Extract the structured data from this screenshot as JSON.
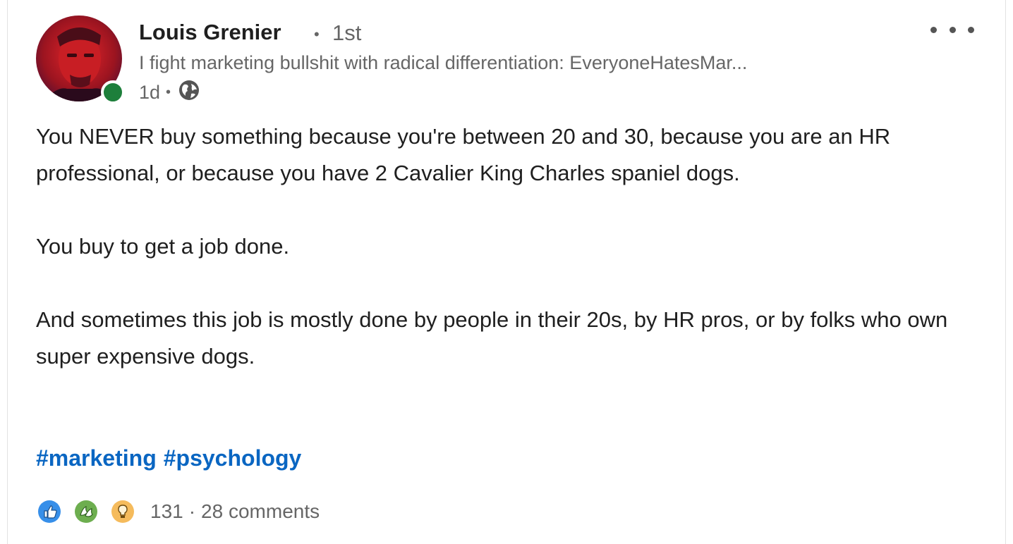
{
  "post": {
    "author": {
      "name": "Louis Grenier",
      "separator": "•",
      "degree": "1st",
      "headline": "I fight marketing bullshit with radical differentiation: EveryoneHatesMar...",
      "time": "1d",
      "time_separator": "•",
      "visibility_icon": "globe-icon",
      "online": true
    },
    "menu_icon": "more-options-icon",
    "body": [
      "You NEVER buy something because you're between 20 and 30, because you are an HR professional, or because you have 2 Cavalier King Charles spaniel dogs.",
      "You buy to get a job done.",
      "And sometimes this job is mostly done by people in their 20s, by HR pros, or by folks who own super expensive dogs."
    ],
    "hashtags": [
      "#marketing",
      "#psychology"
    ],
    "social": {
      "reactions": [
        "like-icon",
        "celebrate-icon",
        "insightful-icon"
      ],
      "reaction_count": "131",
      "separator": "·",
      "comments": "28 comments"
    }
  },
  "colors": {
    "link": "#0a66c2",
    "text": "#1f1f1f",
    "muted": "#666666",
    "presence": "#1d7f3b",
    "like": "#378fe9",
    "celebrate": "#6dae4f",
    "insightful": "#f5bb5c"
  }
}
